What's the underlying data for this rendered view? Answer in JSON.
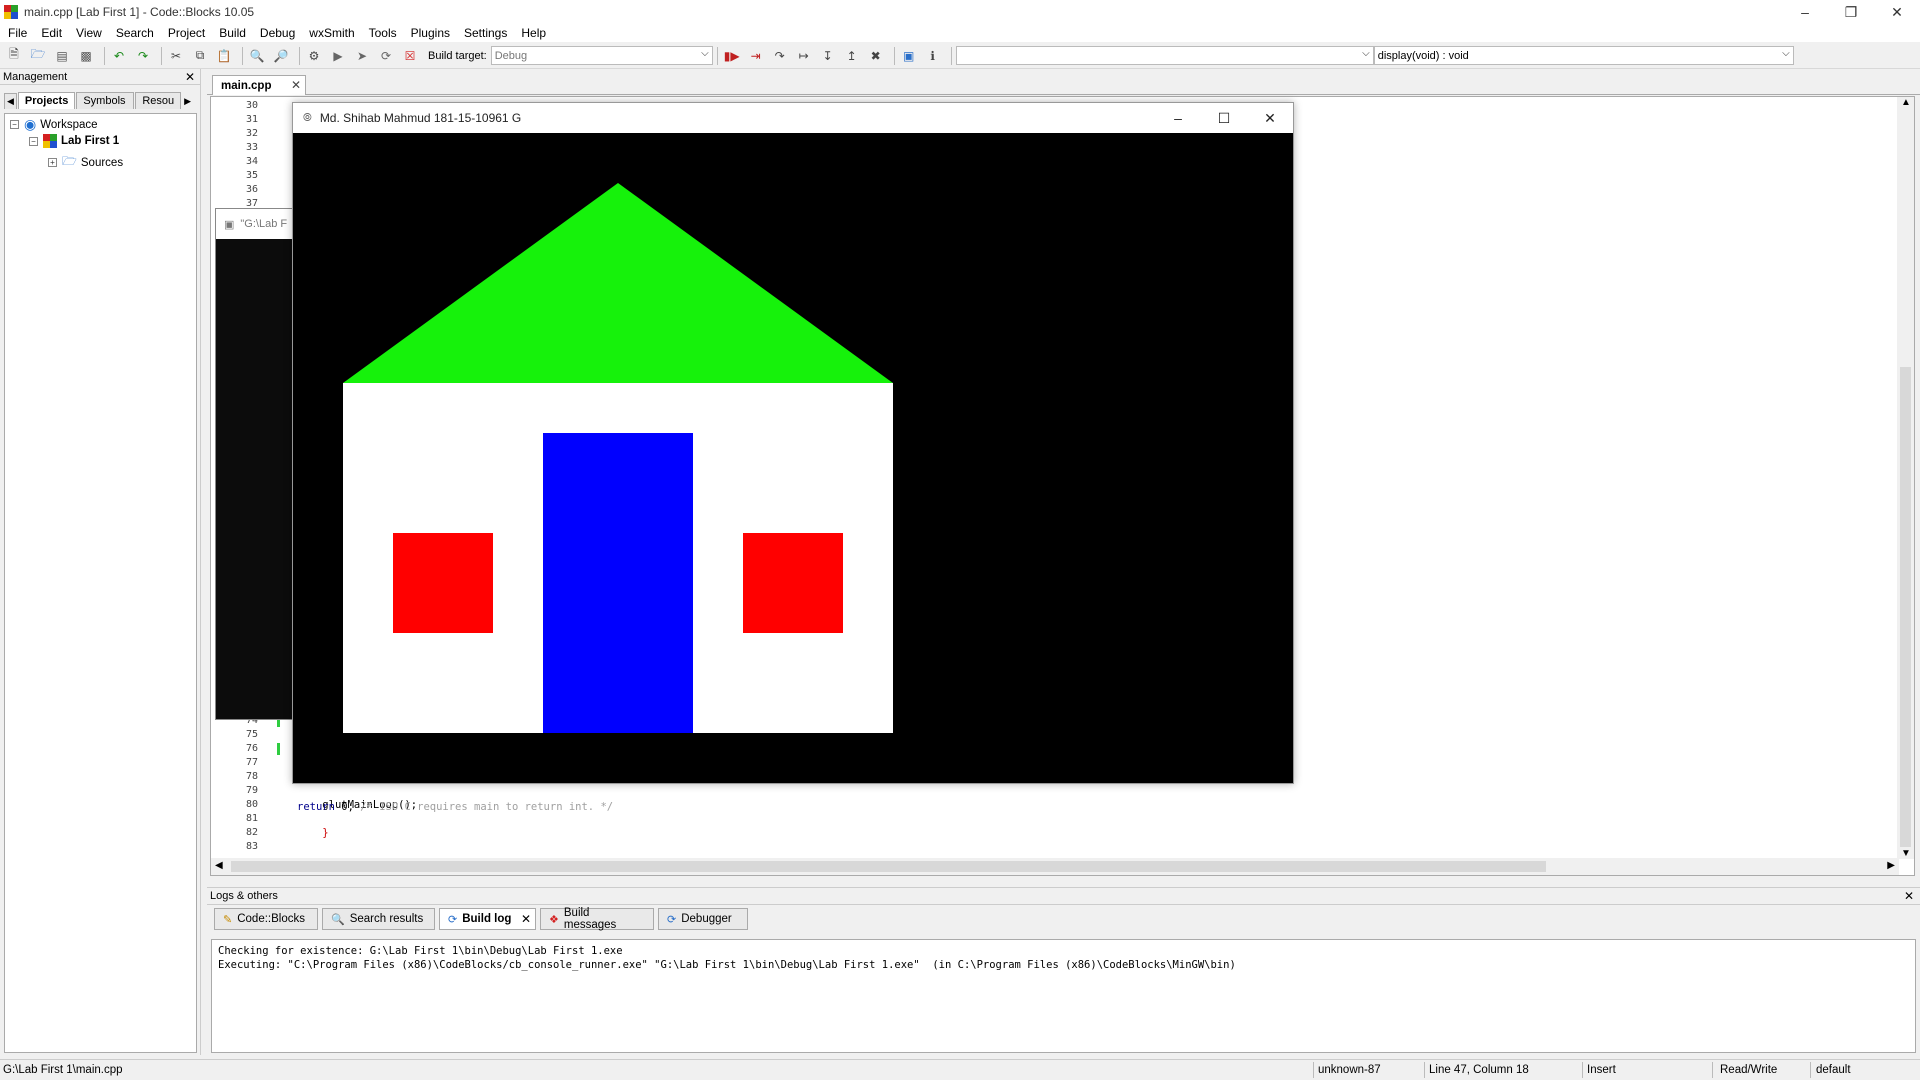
{
  "window": {
    "title": "main.cpp [Lab First 1] - Code::Blocks 10.05"
  },
  "menu": [
    "File",
    "Edit",
    "View",
    "Search",
    "Project",
    "Build",
    "Debug",
    "wxSmith",
    "Tools",
    "Plugins",
    "Settings",
    "Help"
  ],
  "toolbar": {
    "build_target_label": "Build target:",
    "build_target_value": "Debug",
    "symbol_value": "display(void) : void"
  },
  "management": {
    "title": "Management",
    "tabs": [
      "Projects",
      "Symbols",
      "Resou"
    ],
    "tree": {
      "workspace": "Workspace",
      "project": "Lab First 1",
      "sources": "Sources"
    }
  },
  "editor": {
    "tab": "main.cpp",
    "top_lines": [
      "30",
      "31",
      "32",
      "33",
      "34",
      "35",
      "36",
      "37"
    ],
    "bottom_lines": [
      "74",
      "75",
      "76",
      "77",
      "78",
      "79",
      "80",
      "81",
      "82",
      "83"
    ],
    "code": {
      "line79": "glutMainLoop();",
      "line80_kw": "return",
      "line80_val": " 0; ",
      "line80_comment": "/* ISO C requires main to return int. */",
      "line81": "}"
    }
  },
  "console": {
    "title": "\"G:\\Lab F"
  },
  "glut": {
    "title": "Md. Shihab Mahmud 181-15-10961 G",
    "colors": {
      "background": "#000000",
      "roof": "#16f20b",
      "wall": "#ffffff",
      "door": "#0000ff",
      "window": "#ff0000"
    }
  },
  "logs": {
    "title": "Logs & others",
    "tabs": [
      "Code::Blocks",
      "Search results",
      "Build log",
      "Build messages",
      "Debugger"
    ],
    "lines": [
      "Checking for existence: G:\\Lab First 1\\bin\\Debug\\Lab First 1.exe",
      "Executing: \"C:\\Program Files (x86)\\CodeBlocks/cb_console_runner.exe\" \"G:\\Lab First 1\\bin\\Debug\\Lab First 1.exe\"  (in C:\\Program Files (x86)\\CodeBlocks\\MinGW\\bin)"
    ]
  },
  "status": {
    "path": "G:\\Lab First 1\\main.cpp",
    "encoding": "unknown-87",
    "position": "Line 47, Column 18",
    "mode": "Insert",
    "access": "Read/Write",
    "lang": "default"
  }
}
